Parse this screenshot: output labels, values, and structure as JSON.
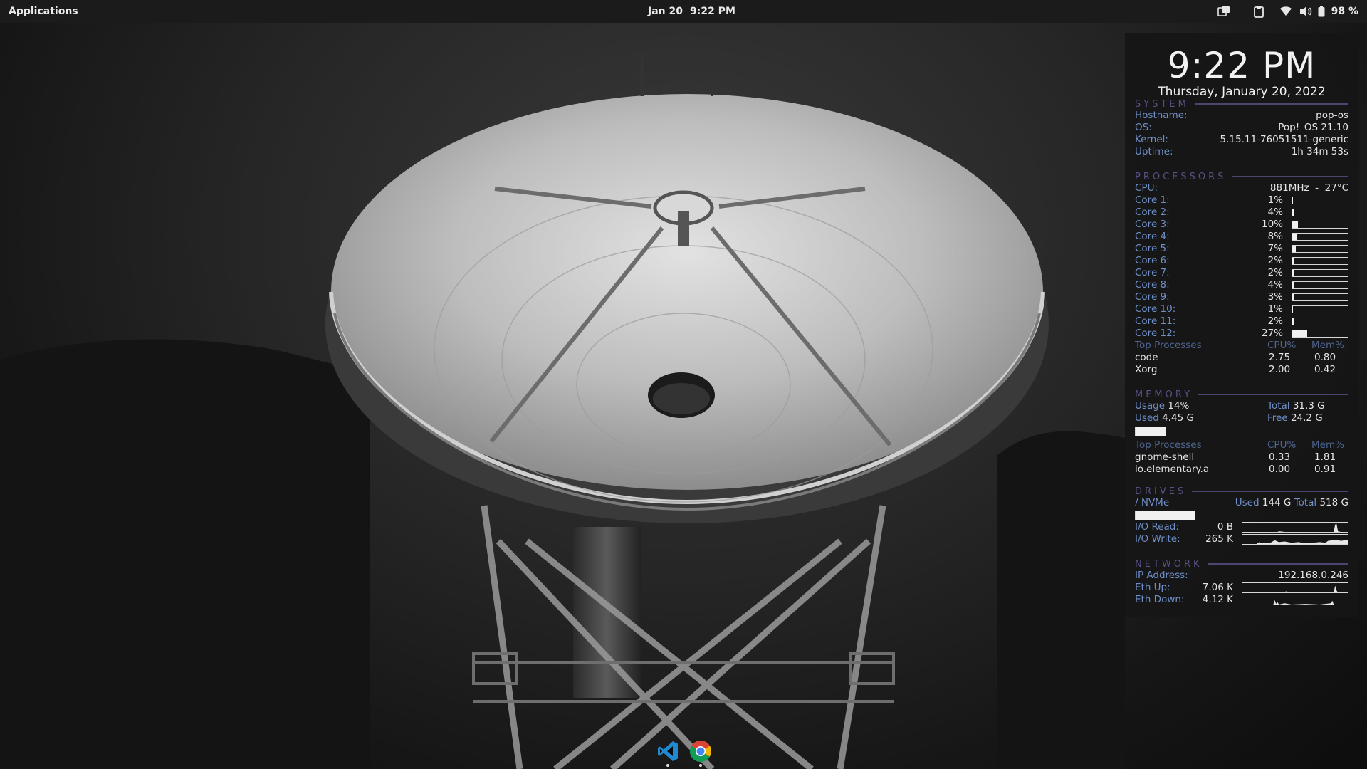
{
  "topbar": {
    "applications_label": "Applications",
    "date": "Jan 20",
    "time": "9:22 PM",
    "battery_percent": "98 %",
    "tray_icons": [
      "window-switcher-icon",
      "clipboard-icon",
      "wifi-icon",
      "volume-icon",
      "battery-icon"
    ]
  },
  "conky": {
    "time": "9:22 PM",
    "date": "Thursday, January 20, 2022",
    "system": {
      "heading": "SYSTEM",
      "hostname_label": "Hostname:",
      "hostname": "pop-os",
      "os_label": "OS:",
      "os": "Pop!_OS 21.10",
      "kernel_label": "Kernel:",
      "kernel": "5.15.11-76051511-generic",
      "uptime_label": "Uptime:",
      "uptime": "1h 34m 53s"
    },
    "processors": {
      "heading": "PROCESSORS",
      "cpu_label": "CPU:",
      "cpu_freq": "881MHz",
      "cpu_sep": "-",
      "cpu_temp": "27°C",
      "cores": [
        {
          "label": "Core 1:",
          "pct": "1%",
          "value": 1
        },
        {
          "label": "Core 2:",
          "pct": "4%",
          "value": 4
        },
        {
          "label": "Core 3:",
          "pct": "10%",
          "value": 10
        },
        {
          "label": "Core 4:",
          "pct": "8%",
          "value": 8
        },
        {
          "label": "Core 5:",
          "pct": "7%",
          "value": 7
        },
        {
          "label": "Core 6:",
          "pct": "2%",
          "value": 2
        },
        {
          "label": "Core 7:",
          "pct": "2%",
          "value": 2
        },
        {
          "label": "Core 8:",
          "pct": "4%",
          "value": 4
        },
        {
          "label": "Core 9:",
          "pct": "3%",
          "value": 3
        },
        {
          "label": "Core 10:",
          "pct": "1%",
          "value": 1
        },
        {
          "label": "Core 11:",
          "pct": "2%",
          "value": 2
        },
        {
          "label": "Core 12:",
          "pct": "27%",
          "value": 27
        }
      ],
      "top_header": "Top Processes",
      "col_cpu": "CPU%",
      "col_mem": "Mem%",
      "top": [
        {
          "name": "code",
          "cpu": "2.75",
          "mem": "0.80"
        },
        {
          "name": "Xorg",
          "cpu": "2.00",
          "mem": "0.42"
        }
      ]
    },
    "memory": {
      "heading": "MEMORY",
      "usage_label": "Usage",
      "usage": "14%",
      "total_label": "Total",
      "total": "31.3 G",
      "used_label": "Used",
      "used": "4.45 G",
      "free_label": "Free",
      "free": "24.2 G",
      "usage_value": 14,
      "top_header": "Top Processes",
      "col_cpu": "CPU%",
      "col_mem": "Mem%",
      "top": [
        {
          "name": "gnome-shell",
          "cpu": "0.33",
          "mem": "1.81"
        },
        {
          "name": "io.elementary.a",
          "cpu": "0.00",
          "mem": "0.91"
        }
      ]
    },
    "drives": {
      "heading": "DRIVES",
      "mount_label": "/ NVMe",
      "used_label": "Used",
      "used": "144 G",
      "total_label": "Total",
      "total": "518 G",
      "used_fraction": 0.278,
      "io_read_label": "I/O Read:",
      "io_read": "0 B",
      "io_write_label": "I/O Write:",
      "io_write": "265 K"
    },
    "network": {
      "heading": "NETWORK",
      "ip_label": "IP Address:",
      "ip": "192.168.0.246",
      "up_label": "Eth Up:",
      "up": "7.06 K",
      "down_label": "Eth Down:",
      "down": "4.12 K"
    }
  },
  "dock": {
    "apps": [
      "vscode-icon",
      "chrome-icon"
    ]
  },
  "colors": {
    "label_blue": "#6f8fc8",
    "heading_purple": "#5b4f86",
    "panel_bg": "#161616",
    "topbar_bg": "#1b1b1b"
  }
}
